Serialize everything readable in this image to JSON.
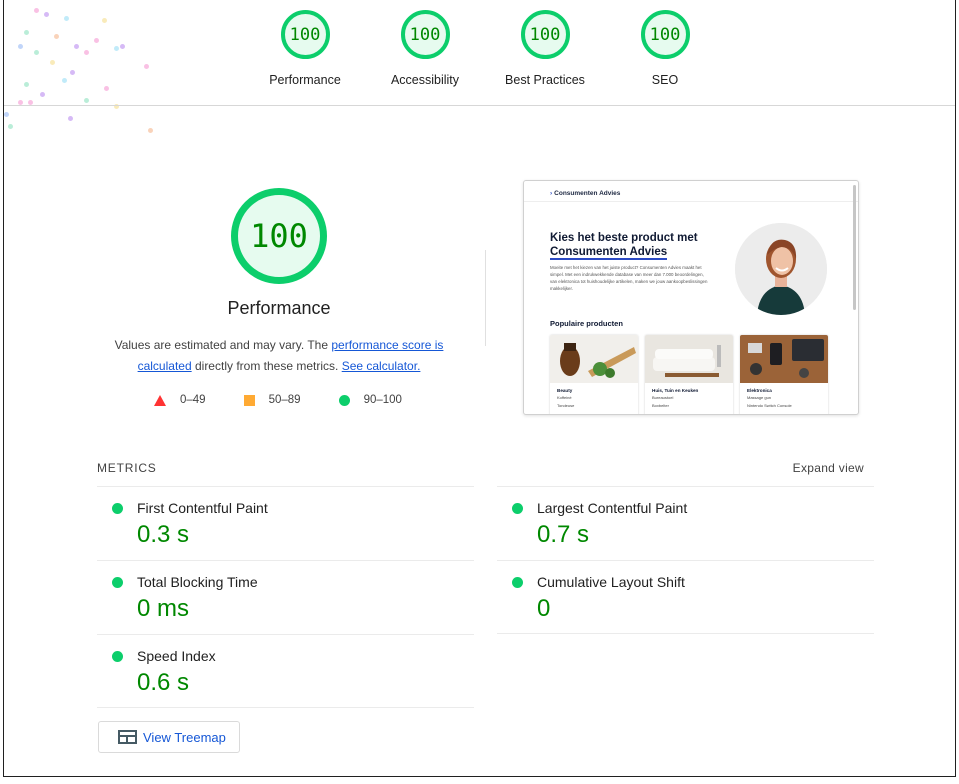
{
  "top_gauges": [
    {
      "score": "100",
      "label": "Performance"
    },
    {
      "score": "100",
      "label": "Accessibility"
    },
    {
      "score": "100",
      "label": "Best Practices"
    },
    {
      "score": "100",
      "label": "SEO"
    }
  ],
  "main_gauge": {
    "score": "100",
    "title": "Performance",
    "note_before": "Values are estimated and may vary. The ",
    "note_link1": "performance score is calculated",
    "note_middle": " directly from these metrics. ",
    "note_link2": "See calculator."
  },
  "legend": [
    {
      "shape": "triangle",
      "range": "0–49",
      "color": "#ff3333"
    },
    {
      "shape": "square",
      "range": "50–89",
      "color": "#ffaa33"
    },
    {
      "shape": "circle",
      "range": "90–100",
      "color": "#0cce6b"
    }
  ],
  "screenshot": {
    "brand": "Consumenten Advies",
    "headline_line1": "Kies het beste product met",
    "headline_line2": "Consumenten Advies",
    "paragraph": "Moeite met het kiezen van het juiste product? Consumenten Advies maakt het simpel. Met een indrukwekkende database van meer dan 7.000 beoordelingen, van elektronica tot huishoudelijke artikelen, maken we jouw aankoopbeslissingen makkelijker.",
    "section_title": "Populaire producten",
    "cards": [
      {
        "title": "Beauty",
        "items": [
          "Koffeiné",
          "Tondeuse"
        ]
      },
      {
        "title": "Huis, Tuin en Keuken",
        "items": [
          "Bureaustoel",
          "Boxbelter"
        ]
      },
      {
        "title": "Elektronica",
        "items": [
          "Massage gun",
          "Nintendo Switch Console"
        ]
      }
    ]
  },
  "metrics": {
    "header": "METRICS",
    "expand_label": "Expand view",
    "left": [
      {
        "name": "First Contentful Paint",
        "value": "0.3 s"
      },
      {
        "name": "Total Blocking Time",
        "value": "0 ms"
      },
      {
        "name": "Speed Index",
        "value": "0.6 s"
      }
    ],
    "right": [
      {
        "name": "Largest Contentful Paint",
        "value": "0.7 s"
      },
      {
        "name": "Cumulative Layout Shift",
        "value": "0"
      }
    ]
  },
  "treemap_label": "View Treemap",
  "colors": {
    "pass": "#0cce6b",
    "pass_text": "#008800",
    "average": "#ffaa33",
    "fail": "#ff3333",
    "link": "#1557d6"
  }
}
